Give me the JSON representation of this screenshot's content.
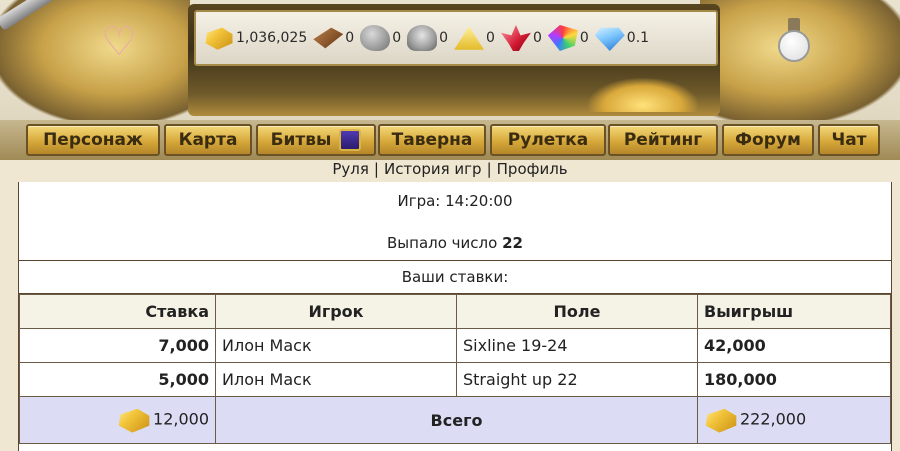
{
  "resources": [
    {
      "name": "gold",
      "icon": "gold-bars-icon",
      "value": "1,036,025"
    },
    {
      "name": "wood",
      "icon": "wood-logs-icon",
      "value": "0"
    },
    {
      "name": "stone",
      "icon": "stone-icon",
      "value": "0"
    },
    {
      "name": "iron",
      "icon": "iron-ore-icon",
      "value": "0"
    },
    {
      "name": "sulfur",
      "icon": "sulfur-icon",
      "value": "0"
    },
    {
      "name": "crystal",
      "icon": "red-crystal-icon",
      "value": "0"
    },
    {
      "name": "gems",
      "icon": "gems-icon",
      "value": "0"
    },
    {
      "name": "diamonds",
      "icon": "diamond-icon",
      "value": "0.1"
    }
  ],
  "nav": [
    {
      "label": "Персонаж"
    },
    {
      "label": "Карта"
    },
    {
      "label": "Битвы"
    },
    {
      "label": "Таверна"
    },
    {
      "label": "Рулетка"
    },
    {
      "label": "Рейтинг"
    },
    {
      "label": "Форум"
    },
    {
      "label": "Чат"
    }
  ],
  "sublinks": {
    "roulette": "Руля",
    "history": "История игр",
    "profile": "Профиль",
    "separator": "|"
  },
  "game": {
    "time_label": "Игра: 14:20:00",
    "result_prefix": "Выпало число",
    "result_number": "22"
  },
  "bets_title": "Ваши ставки:",
  "table": {
    "headers": {
      "stake": "Ставка",
      "player": "Игрок",
      "field": "Поле",
      "win": "Выигрыш"
    },
    "rows": [
      {
        "stake": "7,000",
        "player": "Илон Маск",
        "field": "Sixline 19-24",
        "win": "42,000"
      },
      {
        "stake": "5,000",
        "player": "Илон Маск",
        "field": "Straight up 22",
        "win": "180,000"
      }
    ],
    "total": {
      "stake": "12,000",
      "label": "Всего",
      "win": "222,000"
    }
  },
  "colors": {
    "gold": "#f2c43a",
    "total_row_bg": "#dcdcf5",
    "border": "#5a4530"
  }
}
